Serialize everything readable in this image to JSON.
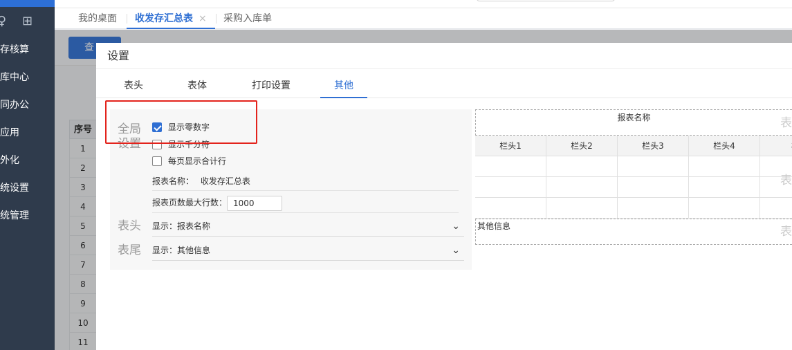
{
  "sidebar": {
    "menu": [
      "存核算",
      "库中心",
      "同办公",
      "应用",
      "外化",
      "统设置",
      "统管理"
    ]
  },
  "tabs": [
    {
      "label": "我的桌面",
      "active": false
    },
    {
      "label": "收发存汇总表",
      "active": true,
      "close": "×"
    },
    {
      "label": "采购入库单",
      "active": false
    }
  ],
  "background": {
    "query_button": "查",
    "table_header": "序号",
    "row_numbers": [
      "1",
      "2",
      "3",
      "4",
      "5",
      "6",
      "7",
      "8",
      "9",
      "10",
      "11"
    ]
  },
  "dialog": {
    "title": "设置",
    "tabs": [
      "表头",
      "表体",
      "打印设置",
      "其他"
    ],
    "active_tab": "其他",
    "global": {
      "section_label_1": "全局",
      "section_label_2": "设置",
      "show_zero": {
        "label": "显示零数字",
        "checked": true
      },
      "show_thousands": {
        "label": "显示千分符",
        "checked": false
      },
      "page_total": {
        "label": "每页显示合计行",
        "checked": false
      },
      "report_name_label": "报表名称：",
      "report_name_value": "收发存汇总表",
      "max_rows_label": "报表页数最大行数：",
      "max_rows_value": "1000"
    },
    "header": {
      "section_label": "表头",
      "select_value": "显示：报表名称"
    },
    "footer": {
      "section_label": "表尾",
      "select_value": "显示：其他信息"
    }
  },
  "preview": {
    "title": "报表名称",
    "columns": [
      "栏头1",
      "栏头2",
      "栏头3",
      "栏头4",
      "栏"
    ],
    "footer_text": "其他信息",
    "edge_mark": "表"
  },
  "colors": {
    "accent": "#2f6fd3",
    "sidebar": "#2f3b4c",
    "highlight_box": "#e3231c"
  }
}
